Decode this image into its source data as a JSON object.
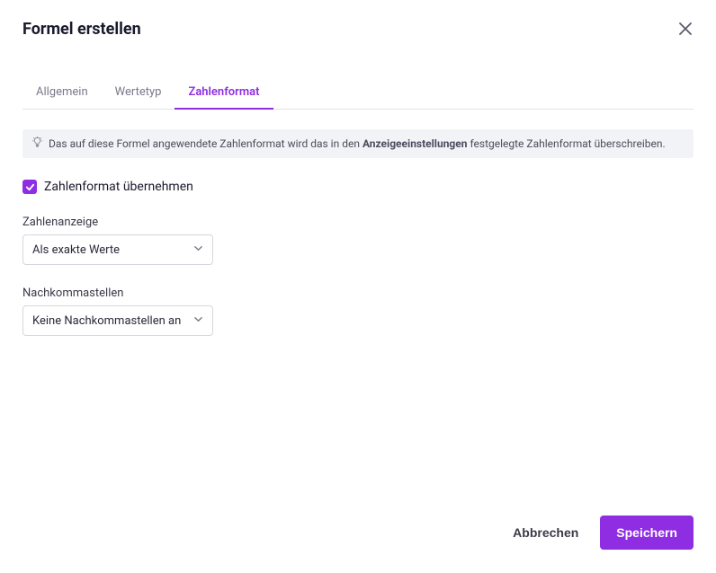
{
  "dialog": {
    "title": "Formel erstellen"
  },
  "tabs": {
    "items": [
      {
        "label": "Allgemein",
        "active": false
      },
      {
        "label": "Wertetyp",
        "active": false
      },
      {
        "label": "Zahlenformat",
        "active": true
      }
    ]
  },
  "banner": {
    "text_pre": "Das auf diese Formel angewendete Zahlenformat wird das in den ",
    "text_bold": "Anzeigeeinstellungen",
    "text_post": " festgelegte Zahlenformat überschreiben."
  },
  "checkbox": {
    "label": "Zahlenformat übernehmen",
    "checked": true
  },
  "fields": {
    "number_display": {
      "label": "Zahlenanzeige",
      "value": "Als exakte Werte"
    },
    "decimals": {
      "label": "Nachkommastellen",
      "value": "Keine Nachkommastellen an"
    }
  },
  "footer": {
    "cancel": "Abbrechen",
    "save": "Speichern"
  }
}
